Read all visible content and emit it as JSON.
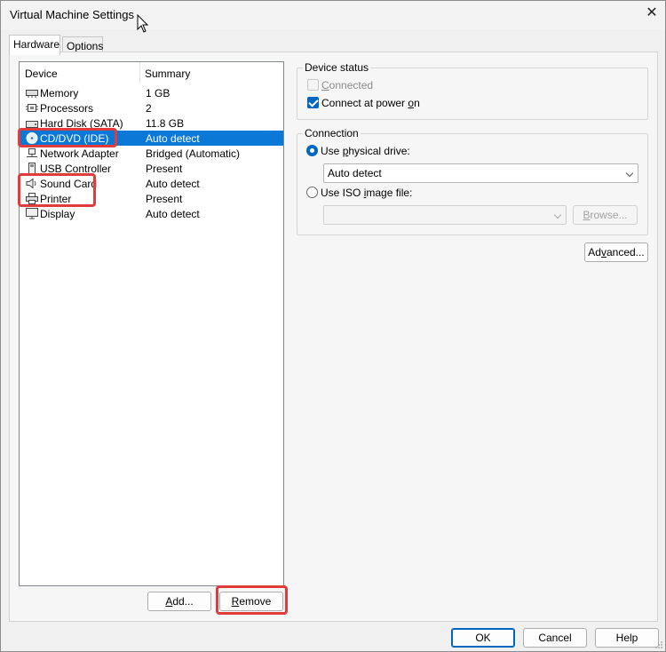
{
  "window": {
    "title": "Virtual Machine Settings",
    "close_glyph": "✕"
  },
  "tabs": [
    {
      "label": "Hardware",
      "active": true
    },
    {
      "label": "Options",
      "active": false
    }
  ],
  "device_list": {
    "headers": {
      "device": "Device",
      "summary": "Summary"
    },
    "rows": [
      {
        "name": "Memory",
        "summary": "1 GB",
        "icon": "memory-icon"
      },
      {
        "name": "Processors",
        "summary": "2",
        "icon": "processor-icon"
      },
      {
        "name": "Hard Disk (SATA)",
        "summary": "11.8 GB",
        "icon": "hard-disk-icon"
      },
      {
        "name": "CD/DVD (IDE)",
        "summary": "Auto detect",
        "icon": "cd-dvd-icon",
        "selected": true
      },
      {
        "name": "Network Adapter",
        "summary": "Bridged (Automatic)",
        "icon": "network-adapter-icon"
      },
      {
        "name": "USB Controller",
        "summary": "Present",
        "icon": "usb-controller-icon"
      },
      {
        "name": "Sound Card",
        "summary": "Auto detect",
        "icon": "sound-card-icon"
      },
      {
        "name": "Printer",
        "summary": "Present",
        "icon": "printer-icon"
      },
      {
        "name": "Display",
        "summary": "Auto detect",
        "icon": "display-icon"
      }
    ],
    "add_button": {
      "pre": "",
      "mnemonic": "A",
      "post": "dd..."
    },
    "remove_button": {
      "pre": "",
      "mnemonic": "R",
      "post": "emove"
    }
  },
  "device_status": {
    "label": "Device status",
    "connected": {
      "pre": "",
      "mnemonic": "C",
      "post": "onnected",
      "checked": false,
      "enabled": false
    },
    "connect_at_power_on": {
      "pre": "Connect at power ",
      "mnemonic": "o",
      "post": "n",
      "checked": true
    }
  },
  "connection": {
    "label": "Connection",
    "use_physical_drive": {
      "pre": "Use ",
      "mnemonic": "p",
      "post": "hysical drive:",
      "selected": true
    },
    "drive_select_value": "Auto detect",
    "use_iso": {
      "pre": "Use ISO ",
      "mnemonic": "i",
      "post": "mage file:",
      "selected": false
    },
    "iso_select_value": "",
    "browse_button": {
      "pre": "",
      "mnemonic": "B",
      "post": "rowse..."
    }
  },
  "advanced_button": {
    "pre": "Ad",
    "mnemonic": "v",
    "post": "anced..."
  },
  "footer": {
    "ok": "OK",
    "cancel": "Cancel",
    "help": "Help"
  },
  "colors": {
    "selection": "#0a78d7",
    "highlight_box": "#e03c3c",
    "accent": "#0067c0"
  }
}
